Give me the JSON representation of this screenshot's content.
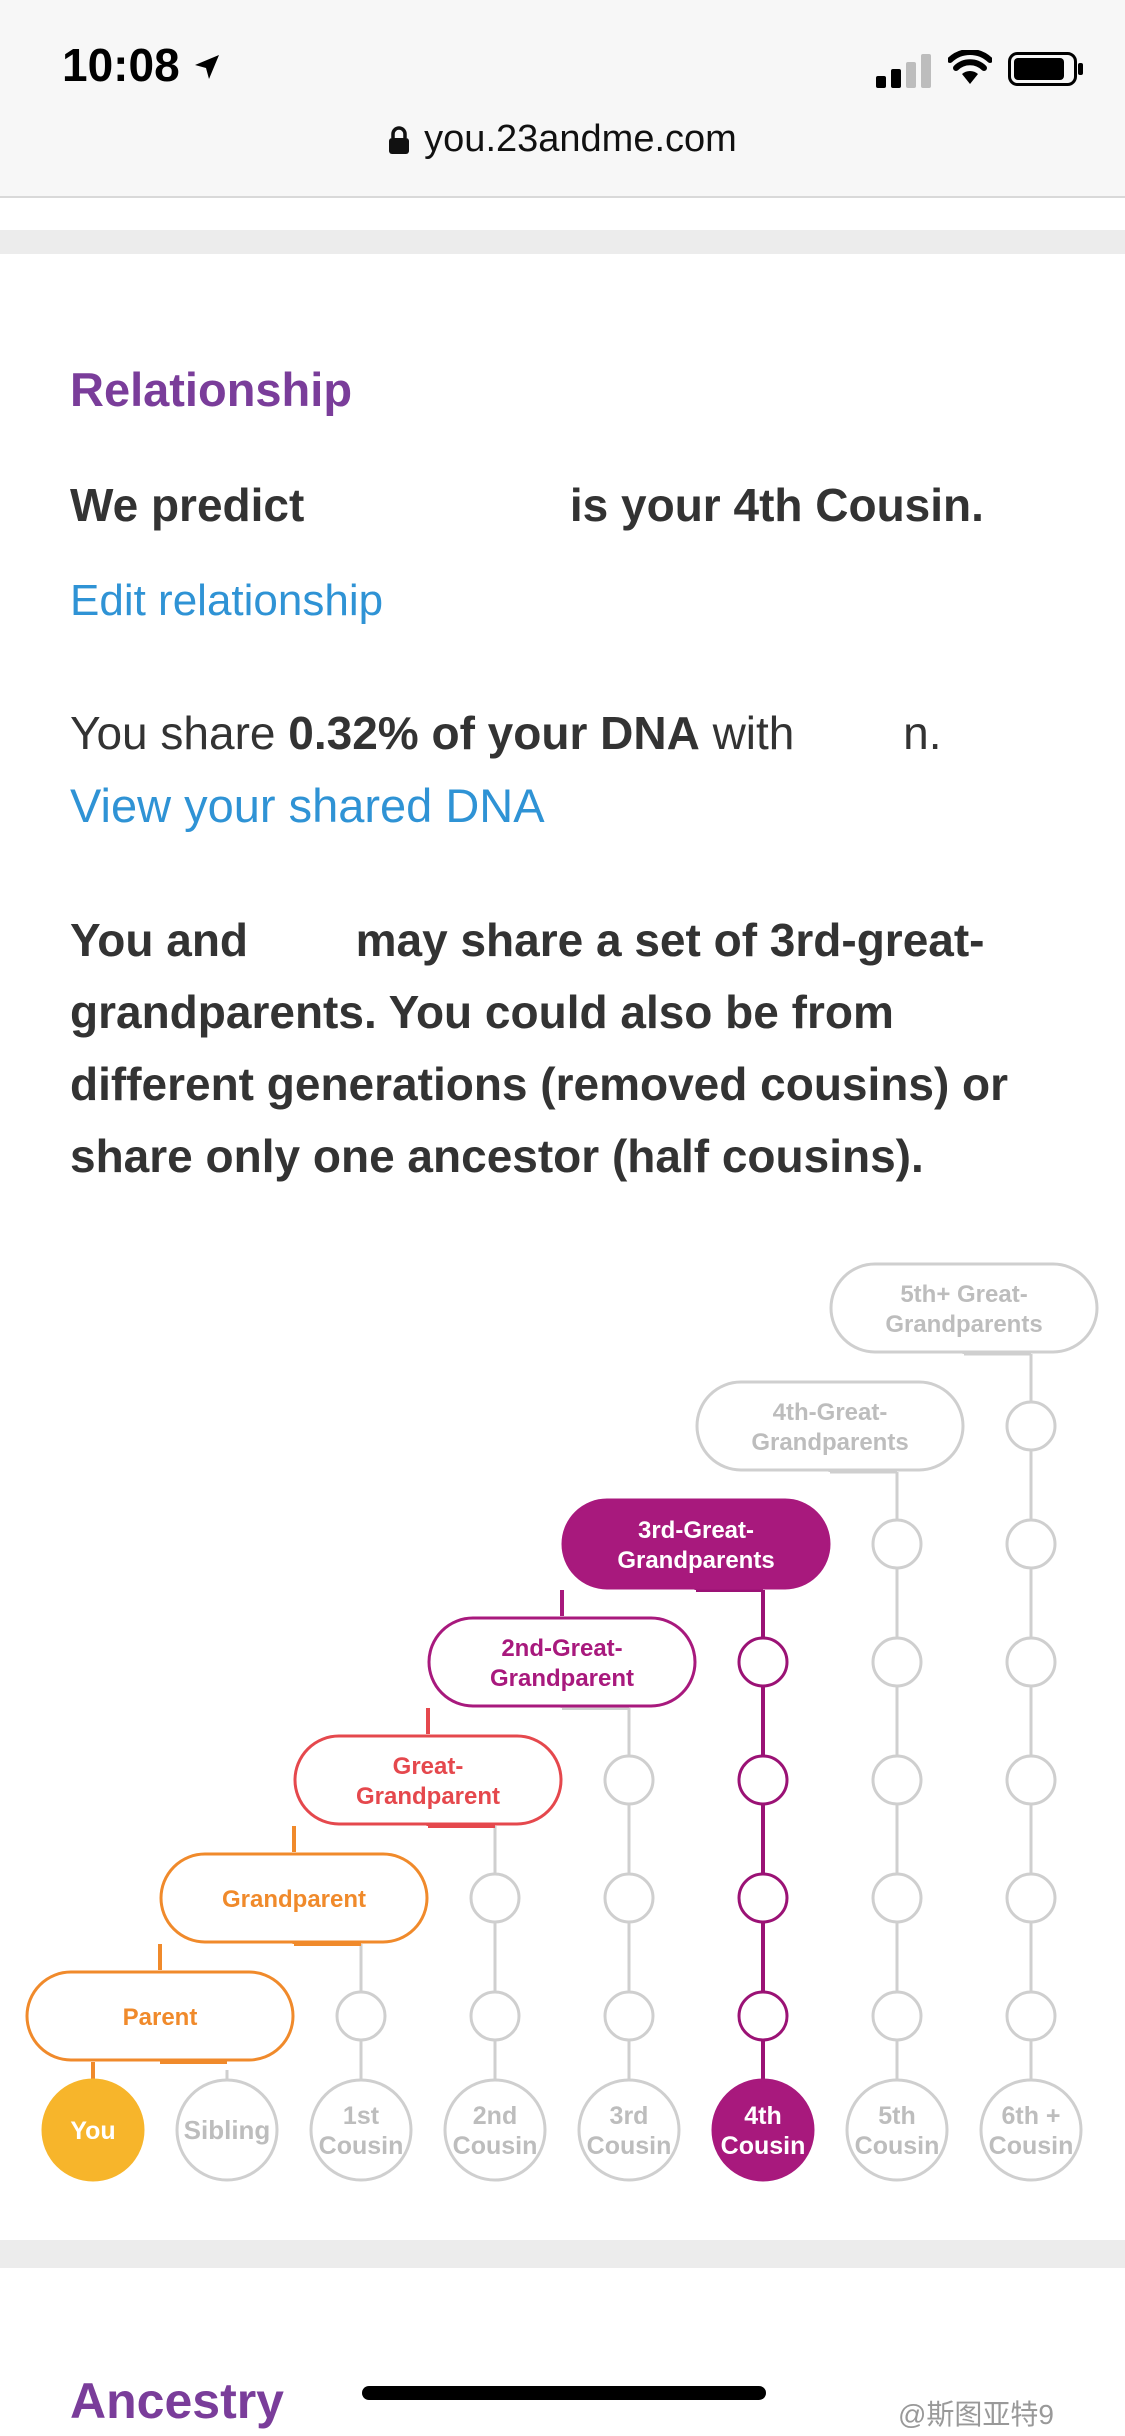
{
  "status": {
    "time": "10:08",
    "url": "you.23andme.com"
  },
  "relationship": {
    "heading": "Relationship",
    "predict_pre": "We predict",
    "predict_post": "is your 4th Cousin.",
    "edit_link": "Edit relationship",
    "share_pre": "You share",
    "share_bold": "0.32% of your DNA",
    "share_mid": "with",
    "share_post": "n.",
    "view_link": "View your shared DNA",
    "para_pre": "You and",
    "para_post": "may share a set of 3rd-great-grandparents. You could also be from different generations (removed cousins) or share only one ancestor (half cousins)."
  },
  "tree": {
    "ancestors": [
      {
        "line1": "Parent",
        "line2": ""
      },
      {
        "line1": "Grandparent",
        "line2": ""
      },
      {
        "line1": "Great-",
        "line2": "Grandparent"
      },
      {
        "line1": "2nd-Great-",
        "line2": "Grandparent"
      },
      {
        "line1": "3rd-Great-",
        "line2": "Grandparents"
      },
      {
        "line1": "4th-Great-",
        "line2": "Grandparents"
      },
      {
        "line1": "5th+ Great-",
        "line2": "Grandparents"
      }
    ],
    "relatives": [
      {
        "line1": "You",
        "line2": ""
      },
      {
        "line1": "Sibling",
        "line2": ""
      },
      {
        "line1": "1st",
        "line2": "Cousin"
      },
      {
        "line1": "2nd",
        "line2": "Cousin"
      },
      {
        "line1": "3rd",
        "line2": "Cousin"
      },
      {
        "line1": "4th",
        "line2": "Cousin"
      },
      {
        "line1": "5th",
        "line2": "Cousin"
      },
      {
        "line1": "6th +",
        "line2": "Cousin"
      }
    ],
    "highlighted": "4th Cousin",
    "colors": {
      "you": "#f7b52b",
      "orange": "#f08a2b",
      "red": "#e5484d",
      "magenta": "#a8197d",
      "magenta_dark": "#9b1275",
      "gray": "#cfcfcf",
      "gray_text": "#bdbdbd"
    }
  },
  "ancestry": {
    "heading": "Ancestry"
  },
  "watermark": "@斯图亚特9"
}
